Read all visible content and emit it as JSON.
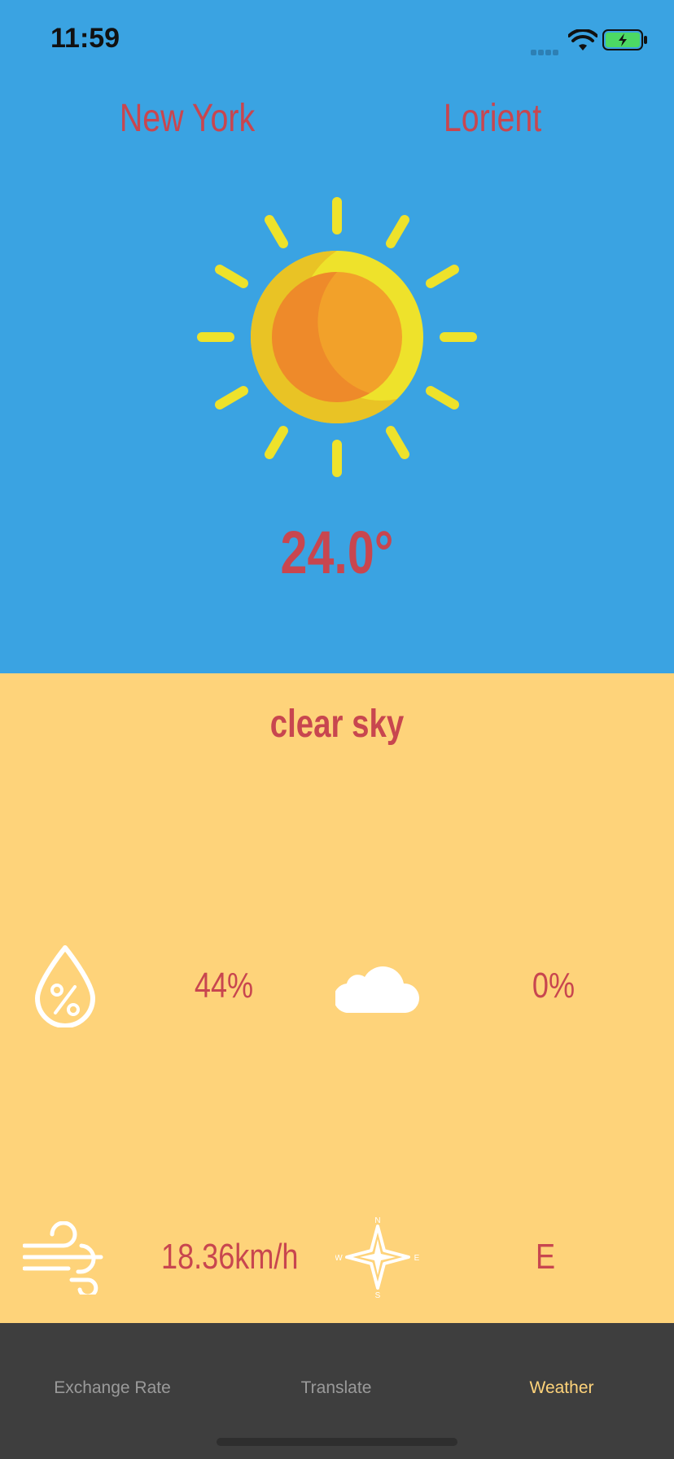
{
  "status_bar": {
    "time": "11:59"
  },
  "header": {
    "city_left": "New York",
    "city_right": "Lorient"
  },
  "current": {
    "temperature": "24.0°",
    "description": "clear sky",
    "icon": "sun-icon"
  },
  "metrics": {
    "humidity": {
      "icon": "humidity-drop-icon",
      "value": "44%"
    },
    "clouds": {
      "icon": "cloud-icon",
      "value": "0%"
    },
    "wind_speed": {
      "icon": "wind-icon",
      "value": "18.36km/h"
    },
    "wind_direction": {
      "icon": "compass-icon",
      "value": "E",
      "compass_labels": {
        "n": "N",
        "e": "E",
        "s": "S",
        "w": "W"
      }
    }
  },
  "tabs": [
    {
      "label": "Exchange Rate",
      "active": false
    },
    {
      "label": "Translate",
      "active": false
    },
    {
      "label": "Weather",
      "active": true
    }
  ],
  "colors": {
    "sky": "#3AA3E2",
    "panel": "#FED37A",
    "accent_text": "#C8464F",
    "tabbar": "#3E3E3E",
    "active_tab": "#FED37A"
  }
}
